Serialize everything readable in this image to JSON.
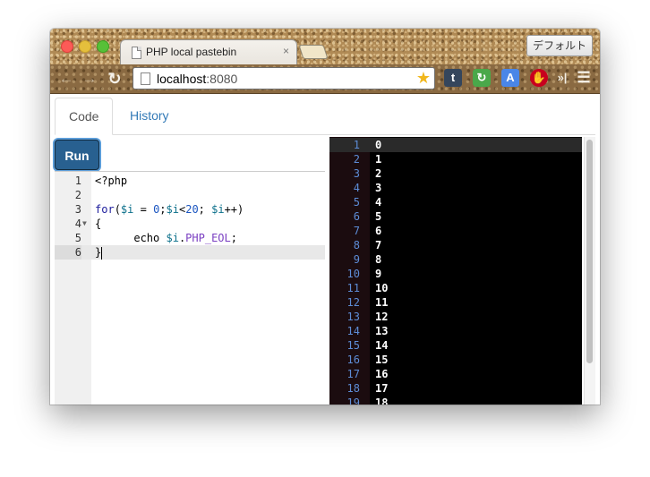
{
  "browser": {
    "tab_title": "PHP local pastebin",
    "tab_close": "×",
    "profile_button": "デフォルト",
    "url_host": "localhost",
    "url_port": ":8080",
    "icons": [
      "back-arrow-icon",
      "forward-arrow-icon",
      "reload-icon",
      "page-icon",
      "star-icon",
      "tumblr-extension-icon",
      "refresh-extension-icon",
      "translate-extension-icon",
      "stop-extension-icon",
      "more-extensions-icon",
      "menu-icon"
    ]
  },
  "nav": {
    "tabs": [
      {
        "label": "Code",
        "active": true
      },
      {
        "label": "History",
        "active": false
      }
    ]
  },
  "run_button": "Run",
  "editor": {
    "line_numbers": [
      "1",
      "2",
      "3",
      "4",
      "5",
      "6"
    ],
    "active_line": 6
  },
  "output": {
    "line_numbers": [
      "1",
      "2",
      "3",
      "4",
      "5",
      "6",
      "7",
      "8",
      "9",
      "10",
      "11",
      "12",
      "13",
      "14",
      "15",
      "16",
      "17",
      "18",
      "19"
    ],
    "lines": [
      "0",
      "1",
      "2",
      "3",
      "4",
      "5",
      "6",
      "7",
      "8",
      "9",
      "10",
      "11",
      "12",
      "13",
      "14",
      "15",
      "16",
      "17",
      "18"
    ]
  },
  "colors": {
    "run_button": "#286090",
    "link": "#337ab7",
    "output_bg": "#000000",
    "output_gutter": "#1b0c0f",
    "output_line_numbers": "#5d8cd6"
  }
}
